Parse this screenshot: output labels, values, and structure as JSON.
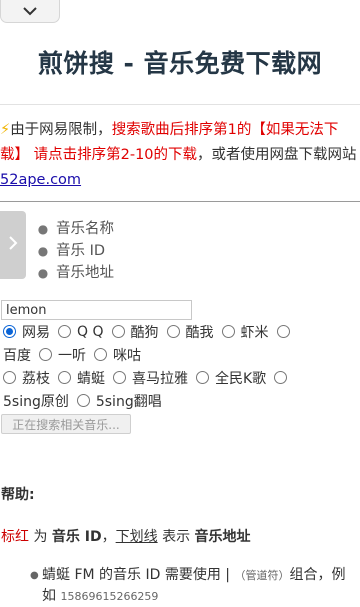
{
  "header": {
    "title": "煎饼搜 - 音乐免费下载网"
  },
  "notice": {
    "bolt": "⚡",
    "part1": "由于网易限制，",
    "part2_red": "搜索歌曲后排序第1的【如果无法下载】 请点击排序第2-10的下载",
    "part3": "，或者使用网盘下载网站",
    "link": "52ape.com"
  },
  "search_types": [
    {
      "label": "音乐名称"
    },
    {
      "label": "音乐 ID"
    },
    {
      "label": "音乐地址"
    }
  ],
  "search": {
    "value": "lemon",
    "button_label": "正在搜索相关音乐..."
  },
  "sources": {
    "selected": "网易",
    "row1": [
      "网易",
      "Q Q",
      "酷狗",
      "酷我",
      "虾米"
    ],
    "row2": [
      "百度",
      "一听",
      "咪咕"
    ],
    "row3": [
      "荔枝",
      "蜻蜓",
      "喜马拉雅",
      "全民K歌"
    ],
    "row4": [
      "5sing原创",
      "5sing翻唱"
    ]
  },
  "help": {
    "title": "帮助:",
    "legend_red": "标红",
    "legend_is": " 为 ",
    "legend_music_id": "音乐 ID",
    "legend_comma": "，",
    "legend_underline": "下划线",
    "legend_means": " 表示 ",
    "legend_music_url": "音乐地址",
    "item1_text": "蜻蜓 FM 的音乐 ID 需要使用",
    "item1_pipe": "|",
    "item1_pipe_note": "（管道符）",
    "item1_rest": "组合，例如",
    "item1_example": "15869615266259"
  },
  "colors": {
    "title": "#253746",
    "accent_red": "#e00000",
    "link": "#1a0dab",
    "radio_selected": "#0a64d6"
  },
  "icons": {
    "top_tab": "chevron-down-icon",
    "side_tab": "chevron-right-icon"
  }
}
